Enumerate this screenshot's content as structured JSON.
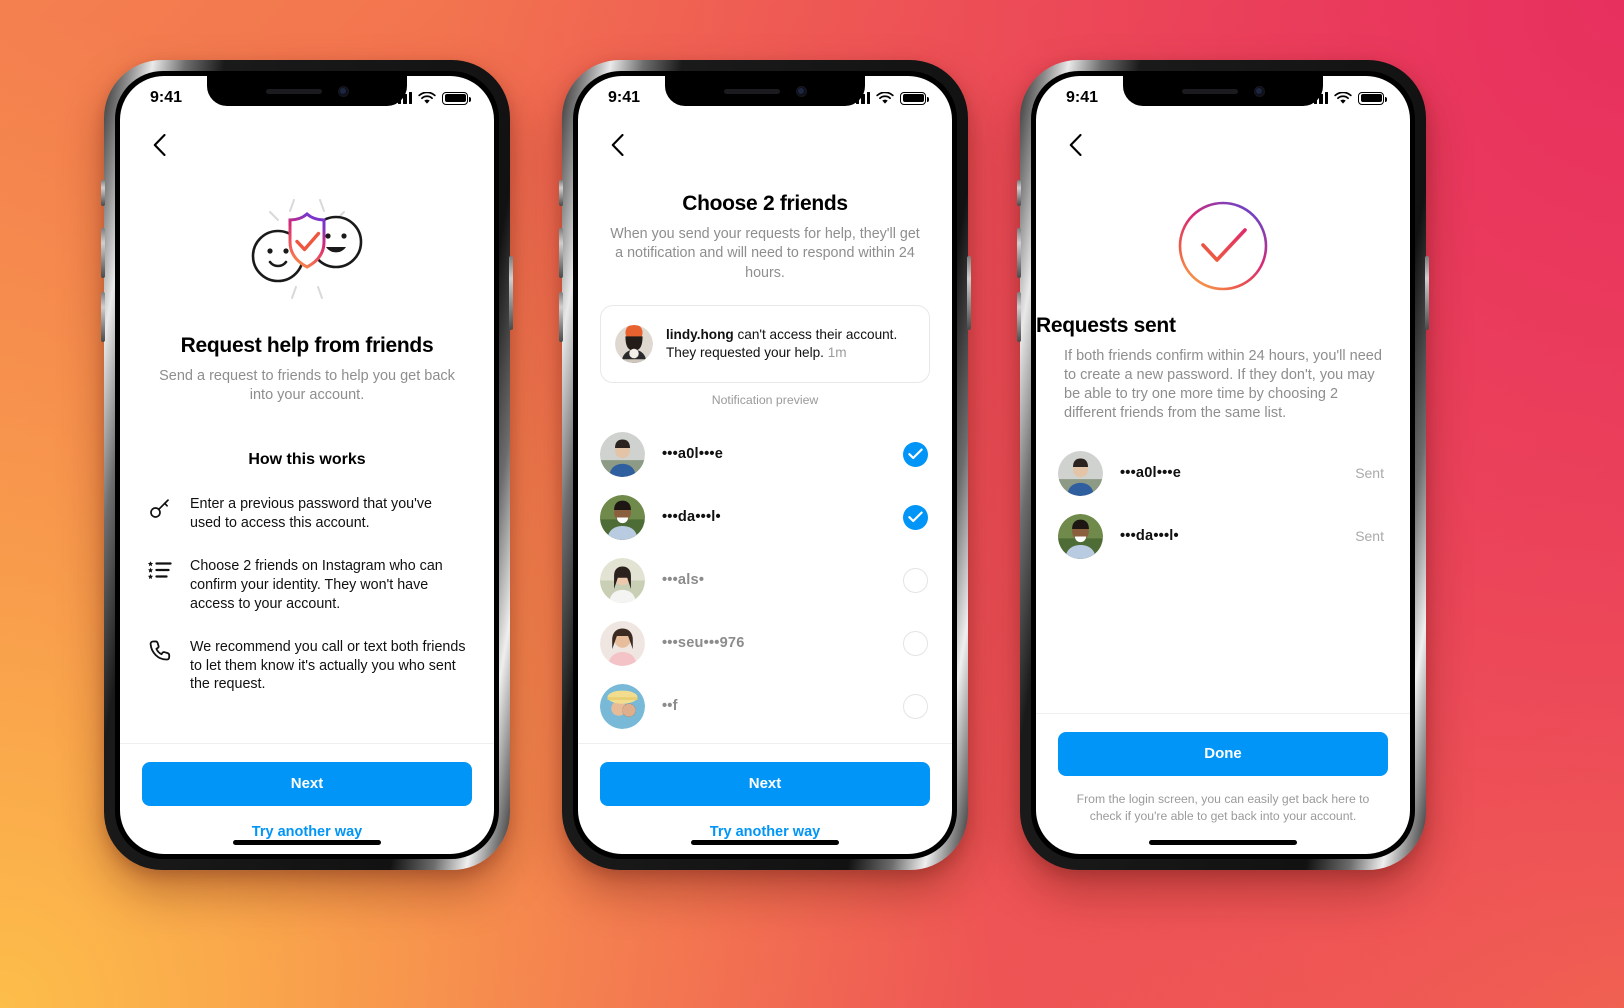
{
  "theme": {
    "accent": "#0095F6",
    "bg_top_left": "#F4804F",
    "bg_top_right": "#E8305F",
    "bg_bottom_left": "#FDBE4A",
    "bg_bottom_right": "#F26A4F",
    "muted_text": "#8e8e8e"
  },
  "status_bar": {
    "time": "9:41",
    "signal": "cellular-bars-icon",
    "wifi": "wifi-icon",
    "battery": "battery-full-icon"
  },
  "screen1": {
    "back": "back-chevron",
    "illustration": "friends-shield-check-illustration",
    "title": "Request help from friends",
    "subtitle": "Send a request to friends to help you get back into your account.",
    "section_title": "How this works",
    "steps": [
      {
        "icon": "key-icon",
        "text": "Enter a previous password that you've used to access this account."
      },
      {
        "icon": "list-icon",
        "text": "Choose 2 friends on Instagram who can confirm your identity. They won't have access to your account."
      },
      {
        "icon": "phone-icon",
        "text": "We recommend you call or text both friends to let them know it's actually you who sent the request."
      }
    ],
    "primary_button": "Next",
    "secondary_link": "Try another way"
  },
  "screen2": {
    "back": "back-chevron",
    "title": "Choose 2 friends",
    "subtitle": "When you send your requests for help, they'll get a notification and will need to respond within 24 hours.",
    "notification": {
      "avatar": "lindy-hong-avatar",
      "username": "lindy.hong",
      "message": " can't access their account. They requested your help.",
      "time": "1m"
    },
    "preview_caption": "Notification preview",
    "friends": [
      {
        "avatar": "friend-avatar-1",
        "name": "•••a0l•••e",
        "selected": true
      },
      {
        "avatar": "friend-avatar-2",
        "name": "•••da•••l•",
        "selected": true
      },
      {
        "avatar": "friend-avatar-3",
        "name": "•••als•",
        "selected": false
      },
      {
        "avatar": "friend-avatar-4",
        "name": "•••seu•••976",
        "selected": false
      },
      {
        "avatar": "friend-avatar-5",
        "name": "••f",
        "selected": false
      }
    ],
    "primary_button": "Next",
    "secondary_link": "Try another way"
  },
  "screen3": {
    "back": "back-chevron",
    "illustration": "gradient-check-circle",
    "title": "Requests sent",
    "subtitle": "If both friends confirm within 24 hours, you'll need to create a new password. If they don't, you may be able to try one more time by choosing 2 different friends from the same list.",
    "sent": [
      {
        "avatar": "friend-avatar-1",
        "name": "•••a0l•••e",
        "status": "Sent"
      },
      {
        "avatar": "friend-avatar-2",
        "name": "•••da•••l•",
        "status": "Sent"
      }
    ],
    "primary_button": "Done",
    "footnote": "From the login screen, you can easily get back here to check if you're able to get back into your account."
  }
}
